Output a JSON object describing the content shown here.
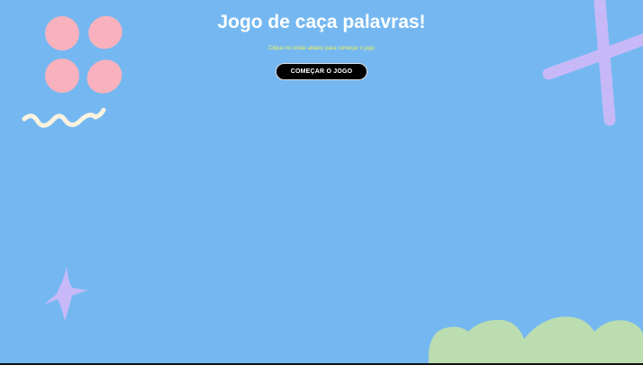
{
  "game": {
    "title": "Jogo de caça palavras!",
    "instructions": "Clique no botão abaixo para começar o jogo",
    "start_button_label": "COMEÇAR O JOGO"
  },
  "colors": {
    "background": "#75b8f1",
    "title_text": "#ffffff",
    "instructions_text": "#f2f25a",
    "button_background": "#000000",
    "button_text": "#ffffff",
    "pink_decoration": "#f8b1bd",
    "purple_decoration": "#c7b9f8",
    "cream_decoration": "#fbf3df",
    "green_decoration": "#bbddb0"
  },
  "decorations": {
    "top_left": "pink-flower-icon",
    "top_left_squiggle": "cream-squiggle-icon",
    "top_right": "purple-cross-icon",
    "bottom_left": "purple-sparkle-icon",
    "bottom_right": "green-bush-icon"
  }
}
